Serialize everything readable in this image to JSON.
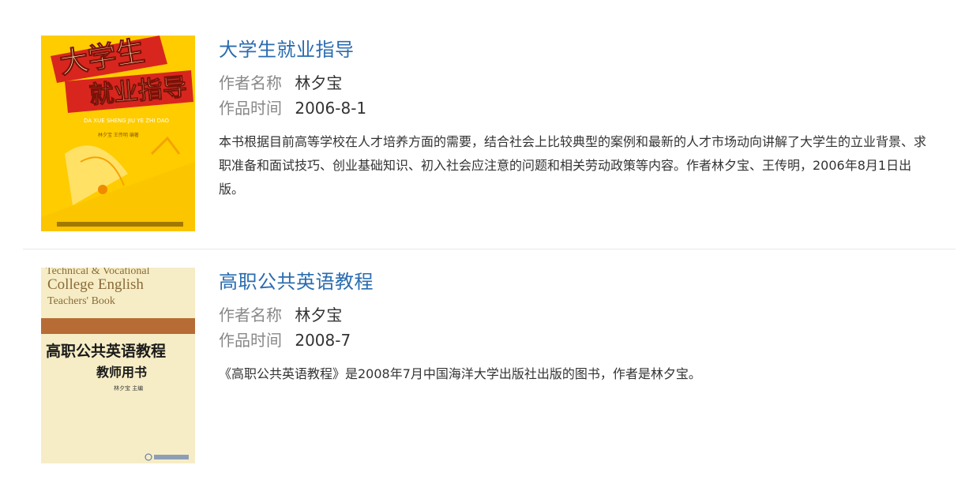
{
  "books": [
    {
      "title": "大学生就业指导",
      "author_label": "作者名称",
      "author": "林夕宝",
      "date_label": "作品时间",
      "date": "2006-8-1",
      "description": "本书根据目前高等学校在人才培养方面的需要，结合社会上比较典型的案例和最新的人才市场动向讲解了大学生的立业背景、求职准备和面试技巧、创业基础知识、初入社会应注意的问题和相关劳动政策等内容。作者林夕宝、王传明，2006年8月1日出版。",
      "cover": {
        "title_top": "大学生",
        "title_bottom": "就业指导",
        "pinyin": "DA XUE SHENG JIU YE ZHI DAO",
        "authors": "林夕宝  王传明  编著"
      }
    },
    {
      "title": "高职公共英语教程",
      "author_label": "作者名称",
      "author": "林夕宝",
      "date_label": "作品时间",
      "date": "2008-7",
      "description": "《高职公共英语教程》是2008年7月中国海洋大学出版社出版的图书，作者是林夕宝。",
      "cover": {
        "en_line1": "Technical & Vocational",
        "en_line2": "College English",
        "en_line3": "Teachers' Book",
        "cn_title": "高职公共英语教程",
        "cn_subtitle": "教师用书",
        "editor": "林夕宝  主编"
      }
    }
  ],
  "colors": {
    "title_link": "#2b6cb0",
    "label": "#888888",
    "text": "#333333"
  }
}
